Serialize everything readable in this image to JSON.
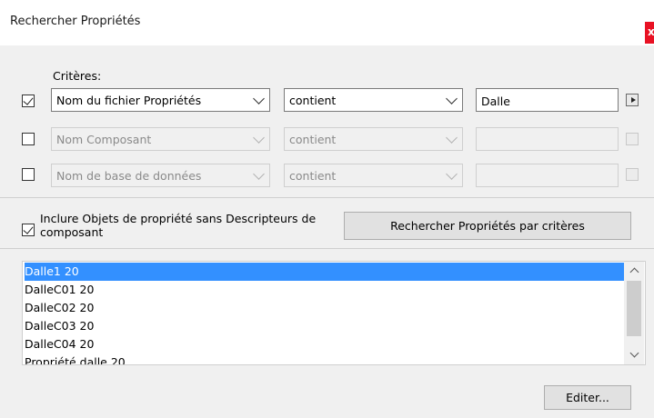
{
  "window": {
    "title": "Rechercher Propriétés",
    "close_label": "x"
  },
  "criteria": {
    "label": "Critères:",
    "rows": [
      {
        "checked": true,
        "enabled": true,
        "field": "Nom du fichier Propriétés",
        "operator": "contient",
        "value": "Dalle"
      },
      {
        "checked": false,
        "enabled": false,
        "field": "Nom Composant",
        "operator": "contient",
        "value": ""
      },
      {
        "checked": false,
        "enabled": false,
        "field": "Nom de base de données",
        "operator": "contient",
        "value": ""
      }
    ]
  },
  "include_option": {
    "checked": true,
    "label": "Inclure Objets de propriété sans Descripteurs de composant"
  },
  "search_button": "Rechercher Propriétés par critères",
  "results": {
    "items": [
      "Dalle1 20",
      "DalleC01 20",
      "DalleC02 20",
      "DalleC03 20",
      "DalleC04 20",
      "Propriété dalle 20"
    ],
    "selected": "Dalle1 20"
  },
  "edit_button": "Editer...",
  "colors": {
    "selection": "#3390ff",
    "close": "#e81123"
  }
}
